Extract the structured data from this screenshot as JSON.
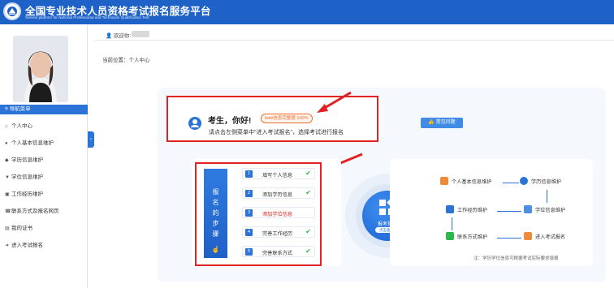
{
  "header": {
    "title": "全国专业技术人员资格考试报名服务平台",
    "subtitle": "Service platform for National Professional and Technician Qualification Test"
  },
  "user": {
    "welcome_label": "欢迎你:"
  },
  "breadcrumb": "当前位置：个人中心",
  "sidebar": {
    "nav_header": "导航菜单",
    "items": [
      {
        "label": "个人中心",
        "icon": "home-icon"
      },
      {
        "label": "个人基本信息维护",
        "icon": "user-icon"
      },
      {
        "label": "学历信息维护",
        "icon": "graduation-cap-icon"
      },
      {
        "label": "学位信息维护",
        "icon": "shield-icon"
      },
      {
        "label": "工作经历维护",
        "icon": "building-icon"
      },
      {
        "label": "联系方式及报名网页",
        "icon": "phone-icon"
      },
      {
        "label": "我的证书",
        "icon": "certificate-icon"
      },
      {
        "label": "进入考试报名",
        "icon": "arrow-circle-icon"
      }
    ]
  },
  "greeting": {
    "title": "考生，你好!",
    "progress": "babi信息完整度:100%",
    "description": "请点击左侧菜单中\"进入考试报名\"，选择考试进行报名"
  },
  "faq_button": "常见问题",
  "steps": {
    "banner": "报名的步骤",
    "items": [
      {
        "num": "1",
        "label": "填写个人信息",
        "done": true
      },
      {
        "num": "2",
        "label": "添加学历信息",
        "done": true
      },
      {
        "num": "3",
        "label": "添加学位信息",
        "done": false
      },
      {
        "num": "4",
        "label": "完善工作经历",
        "done": true
      },
      {
        "num": "5",
        "label": "完善联系方式",
        "done": true
      }
    ],
    "check_symbol": "✔"
  },
  "center": {
    "label": "报考指南",
    "pill": "点击查看"
  },
  "flow": {
    "nodes": [
      "个人基本信息维护",
      "学历信息维护",
      "学位信息维护",
      "工作经历维护",
      "联系方式维护",
      "进入考试报名"
    ],
    "note": "注：学历学位信息可根据考试实际要求填报"
  },
  "colors": {
    "brand_blue": "#1e62c8",
    "highlight_red": "#e02222",
    "progress_orange": "#ee6b2a",
    "check_green": "#2db84d"
  }
}
